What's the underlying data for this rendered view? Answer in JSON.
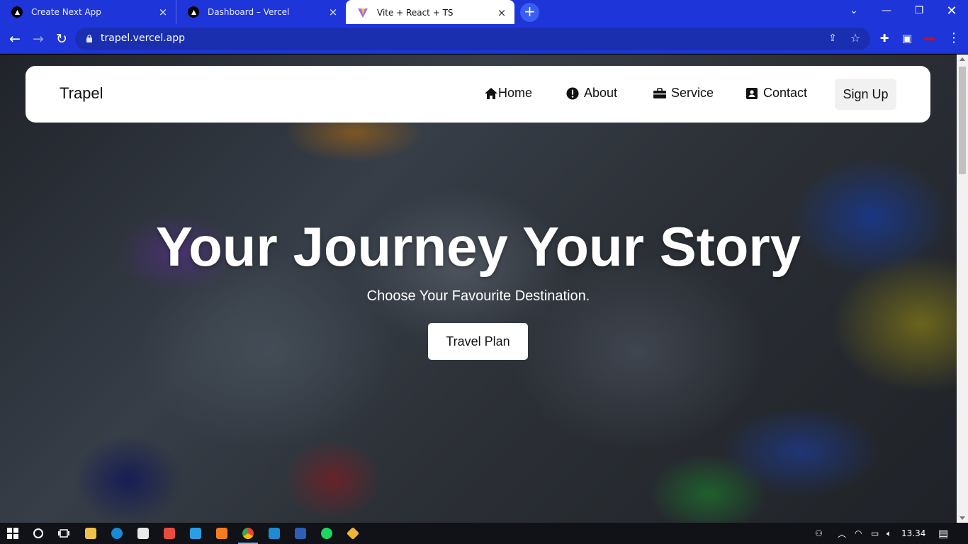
{
  "browser": {
    "tabs": [
      {
        "title": "Create Next App",
        "icon": "vercel-triangle-icon",
        "active": false
      },
      {
        "title": "Dashboard – Vercel",
        "icon": "vercel-triangle-icon",
        "active": false
      },
      {
        "title": "Vite + React + TS",
        "icon": "vite-icon",
        "active": true
      }
    ],
    "url": "trapel.vercel.app"
  },
  "page": {
    "brand": "Trapel",
    "nav": [
      {
        "label": "Home",
        "icon": "home-icon"
      },
      {
        "label": "About",
        "icon": "exclamation-circle-icon"
      },
      {
        "label": "Service",
        "icon": "briefcase-icon"
      },
      {
        "label": "Contact",
        "icon": "contact-card-icon"
      }
    ],
    "signup_label": "Sign Up",
    "hero": {
      "title": "Your Journey Your Story",
      "subtitle": "Choose Your Favourite Destination.",
      "cta_label": "Travel Plan"
    }
  },
  "taskbar": {
    "apps": [
      "file-explorer-icon",
      "edge-icon",
      "store-icon",
      "gift-app-icon",
      "mail-icon",
      "xampp-icon",
      "chrome-icon",
      "vscode-icon",
      "word-icon",
      "spotify-icon",
      "git-icon"
    ],
    "active_app": "chrome-icon",
    "time": "13.34"
  },
  "colors": {
    "browser_chrome": "#1e35d9",
    "taskbar": "#101218",
    "navbar_bg": "#ffffff",
    "signup_bg": "#f1f1f1"
  }
}
